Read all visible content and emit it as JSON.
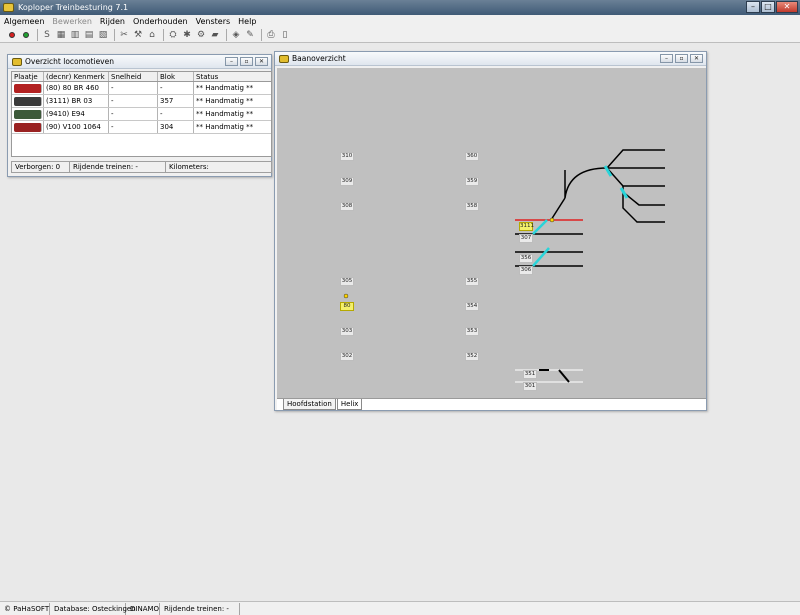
{
  "app": {
    "title": "Koploper Treinbesturing 7.1"
  },
  "menu": [
    "Algemeen",
    "Bewerken",
    "Rijden",
    "Onderhouden",
    "Vensters",
    "Help"
  ],
  "menu_disabled": [
    1
  ],
  "toolbar": {
    "icons": [
      "signal-red-icon",
      "signal-green-icon",
      "sep",
      "s-icon",
      "grid1-icon",
      "grid2-icon",
      "grid3-icon",
      "grid4-icon",
      "sep",
      "tool1-icon",
      "tool2-icon",
      "lock-icon",
      "sep",
      "tool3-icon",
      "tool4-icon",
      "tool5-icon",
      "loco-icon",
      "sep",
      "tool6-icon",
      "tool7-icon",
      "sep",
      "print-icon",
      "page-icon"
    ]
  },
  "loco_window": {
    "title": "Overzicht locomotieven",
    "columns": [
      "Plaatje",
      "(decnr) Kenmerk",
      "Snelheid",
      "Blok",
      "Status"
    ],
    "rows": [
      {
        "kenmerk": "(80) 80 BR 460",
        "snelheid": "-",
        "blok": "-",
        "status": "** Handmatig **",
        "color": "#b22020"
      },
      {
        "kenmerk": "(3111) BR 03",
        "snelheid": "-",
        "blok": "357",
        "status": "** Handmatig **",
        "color": "#3a3a3a"
      },
      {
        "kenmerk": "(9410) E94",
        "snelheid": "-",
        "blok": "-",
        "status": "** Handmatig **",
        "color": "#3d5a3a"
      },
      {
        "kenmerk": "(90) V100 1064",
        "snelheid": "-",
        "blok": "304",
        "status": "** Handmatig **",
        "color": "#9a2222"
      }
    ],
    "footer": {
      "verborgen": "Verborgen: 0",
      "rijdende": "Rijdende treinen: -",
      "kilometers": "Kilometers:"
    }
  },
  "track_window": {
    "title": "Baanoverzicht",
    "tabs": [
      "Hoofdstation",
      "Helix"
    ],
    "active_tab": 1,
    "blocks": [
      {
        "label": "310"
      },
      {
        "label": "309"
      },
      {
        "label": "308"
      },
      {
        "label": "305"
      },
      {
        "label": "80",
        "highlight": true
      },
      {
        "label": "303"
      },
      {
        "label": "302"
      },
      {
        "label": "360"
      },
      {
        "label": "359"
      },
      {
        "label": "358"
      },
      {
        "label": "355"
      },
      {
        "label": "354"
      },
      {
        "label": "353"
      },
      {
        "label": "352"
      },
      {
        "label": "3111",
        "highlight": true
      },
      {
        "label": "307"
      },
      {
        "label": "356"
      },
      {
        "label": "306"
      },
      {
        "label": "351"
      },
      {
        "label": "301"
      }
    ]
  },
  "statusbar": [
    "© PaHaSOFT",
    "Database: Osteckingen",
    "DINAMO",
    "Rijdende treinen: -"
  ],
  "colors": {
    "track": "#000000",
    "switch": "#29d4d9",
    "occupied": "#e02020",
    "titlebar": "#3f5a76"
  }
}
